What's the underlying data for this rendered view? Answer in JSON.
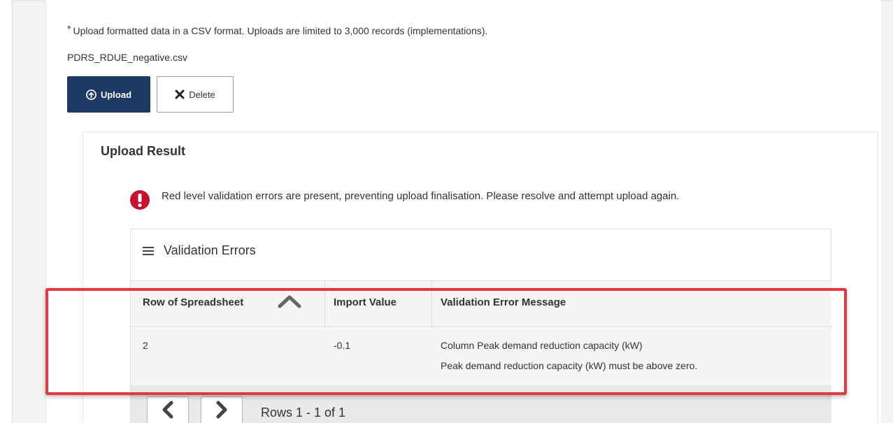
{
  "upload_form": {
    "note_marker": "*",
    "note": "Upload formatted data in a CSV format. Uploads are limited to 3,000 records (implementations).",
    "file_name": "PDRS_RDUE_negative.csv",
    "upload_button": "Upload",
    "delete_button": "Delete"
  },
  "upload_result": {
    "title": "Upload Result",
    "alert": {
      "icon": "exclamation-circle-icon",
      "color": "#c8102e",
      "message": "Red level validation errors are present, preventing upload finalisation. Please resolve and attempt upload again."
    },
    "validation_errors": {
      "title": "Validation Errors",
      "columns": [
        "Row of Spreadsheet",
        "Import Value",
        "Validation Error Message"
      ],
      "rows": [
        {
          "row": "2",
          "import_value": "-0.1",
          "message_line1": "Column Peak demand reduction capacity (kW)",
          "message_line2": "Peak demand reduction capacity (kW) must be above zero."
        }
      ],
      "pager": {
        "summary": "Rows 1 - 1 of 1"
      }
    }
  },
  "annotation": {
    "highlight_color": "#e2383f"
  },
  "theme": {
    "primary_button": "#1c3a63"
  }
}
